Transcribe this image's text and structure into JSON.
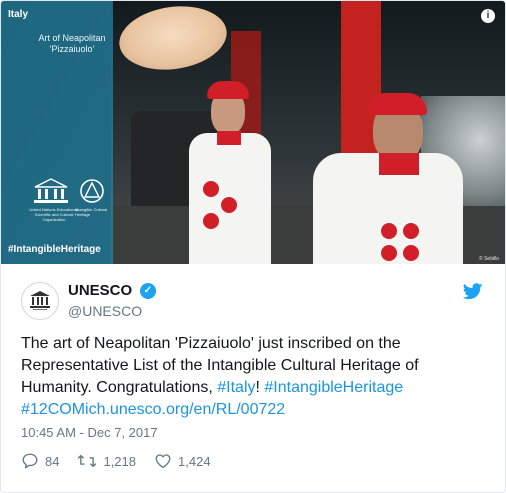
{
  "media": {
    "overlay_country": "Italy",
    "overlay_title": "Art of Neapolitan 'Pizzaiuolo'",
    "overlay_org_text": "United Nations Educational, Scientific and Cultural Organization",
    "overlay_ich_text": "Intangible Cultural Heritage",
    "overlay_hashtag": "#IntangibleHeritage",
    "photo_credit": "© Sebillo",
    "info_icon": "i"
  },
  "tweet": {
    "author_name": "UNESCO",
    "author_handle": "@UNESCO",
    "text_prefix": "The art of Neapolitan 'Pizzaiuolo' just inscribed on the Representative List of the Intangible Cultural Heritage of Humanity. Congratulations, ",
    "link_italy": "#Italy",
    "text_mid": "! ",
    "link_intangible": "#IntangibleHeritage",
    "text_break": " ",
    "link_12com": "#12COM",
    "link_url": "ich.unesco.org/en/RL/00722",
    "timestamp": "10:45 AM - Dec 7, 2017",
    "replies": "84",
    "retweets": "1,218",
    "likes": "1,424"
  },
  "colors": {
    "accent": "#1da1f2",
    "link": "#1b95e0",
    "overlay": "#2896b9",
    "red": "#d11f2a"
  },
  "icons": [
    "info-icon",
    "unesco-logo",
    "verified-badge-icon",
    "twitter-bird-icon",
    "reply-icon",
    "retweet-icon",
    "like-icon"
  ]
}
